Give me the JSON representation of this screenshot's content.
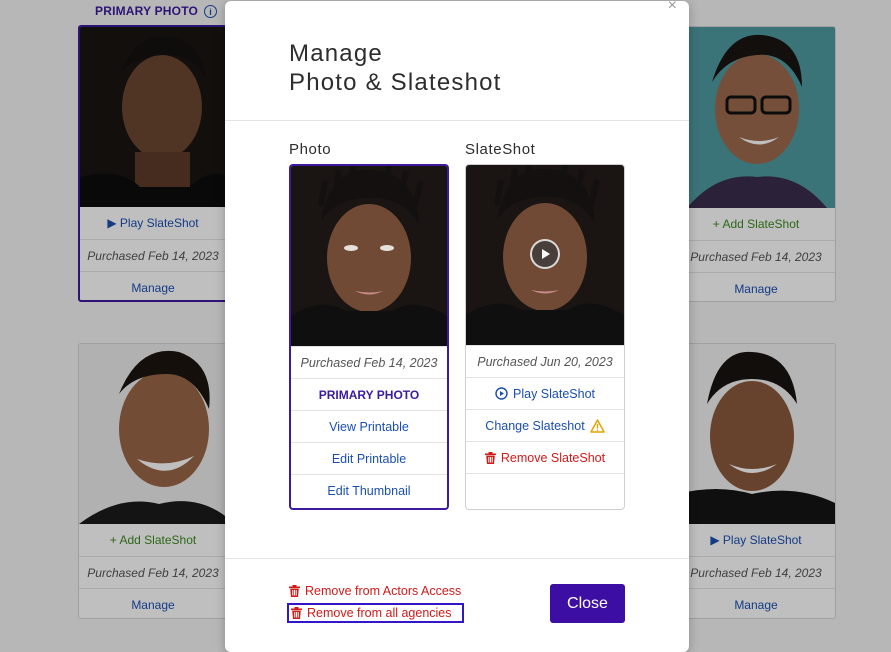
{
  "background": {
    "primary_label": "PRIMARY PHOTO",
    "info_icon": "i",
    "cards": [
      {
        "action": "▶ Play SlateShot",
        "date": "Purchased Feb 14, 2023",
        "manage": "Manage"
      },
      {
        "action": "+ Add SlateShot",
        "date": "Purchased Feb 14, 2023",
        "manage": "Manage"
      },
      {
        "action": "+ Add SlateShot",
        "date": "Purchased Feb 14, 2023",
        "manage": "Manage"
      },
      {
        "action": "▶ Play SlateShot",
        "date": "Purchased Feb 14, 2023",
        "manage": "Manage"
      }
    ]
  },
  "modal": {
    "close_x": "×",
    "title_line1": "Manage",
    "title_line2": "Photo & Slateshot",
    "photo": {
      "heading": "Photo",
      "date": "Purchased Feb 14, 2023",
      "primary": "PRIMARY PHOTO",
      "view_printable": "View Printable",
      "edit_printable": "Edit Printable",
      "edit_thumbnail": "Edit Thumbnail"
    },
    "slate": {
      "heading": "SlateShot",
      "date": "Purchased Jun 20, 2023",
      "play": "Play SlateShot",
      "change": "Change Slateshot",
      "remove": "Remove SlateShot"
    },
    "remove_actors_access": "Remove from Actors Access",
    "remove_all_agencies": "Remove from all agencies",
    "close_button": "Close"
  },
  "colors": {
    "accent_purple": "#3d0ea3",
    "link_blue": "#1a4fb0",
    "danger_red": "#d11a1a",
    "warning_yellow": "#e2a400",
    "add_green": "#3d8a1f"
  },
  "icons": [
    "info-icon",
    "play-circle-icon",
    "warning-icon",
    "trash-icon",
    "close-icon",
    "play-icon"
  ]
}
